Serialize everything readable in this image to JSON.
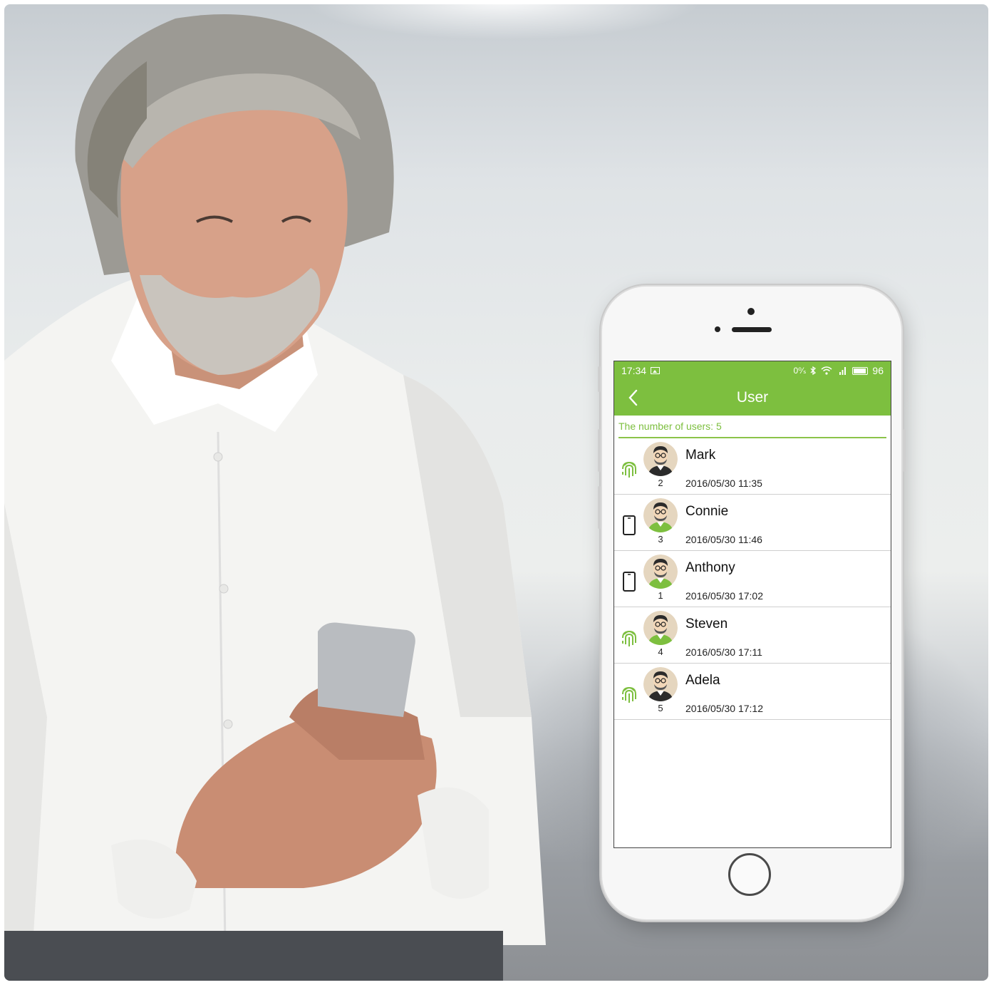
{
  "statusbar": {
    "time": "17:34",
    "net_speed": "0⁰⁄ₛ",
    "battery": "96"
  },
  "header": {
    "title": "User"
  },
  "summary": {
    "label": "The number of users: 5"
  },
  "colors": {
    "accent": "#7dbf3f",
    "accent_light": "#8bc34a"
  },
  "users": [
    {
      "name": "Mark",
      "id": "2",
      "time": "2016/05/30 11:35",
      "method_icon": "fingerprint-icon",
      "shirt": "dark"
    },
    {
      "name": "Connie",
      "id": "3",
      "time": "2016/05/30 11:46",
      "method_icon": "phone-icon",
      "shirt": "green"
    },
    {
      "name": "Anthony",
      "id": "1",
      "time": "2016/05/30 17:02",
      "method_icon": "phone-icon",
      "shirt": "green"
    },
    {
      "name": "Steven",
      "id": "4",
      "time": "2016/05/30 17:11",
      "method_icon": "fingerprint-icon",
      "shirt": "green"
    },
    {
      "name": "Adela",
      "id": "5",
      "time": "2016/05/30 17:12",
      "method_icon": "fingerprint-icon",
      "shirt": "dark"
    }
  ]
}
